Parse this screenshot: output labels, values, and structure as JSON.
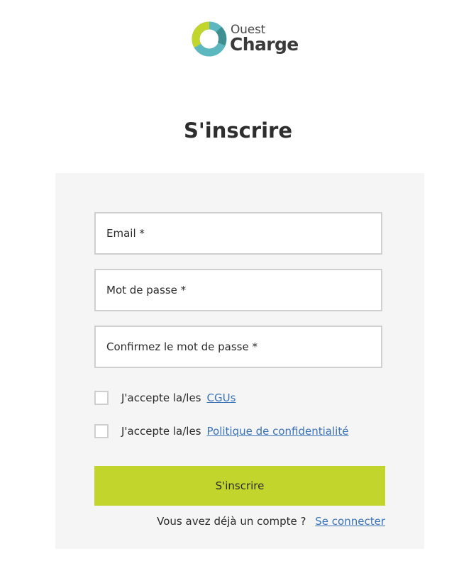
{
  "brand": {
    "logo_line1": "Ouest",
    "logo_line2": "Charge",
    "colors": {
      "lime": "#c2d52c",
      "teal": "#5cb8be",
      "dark_teal": "#3f8e92"
    }
  },
  "header": {
    "title": "S'inscrire"
  },
  "form": {
    "email_placeholder": "Email *",
    "password_placeholder": "Mot de passe *",
    "confirm_placeholder": "Confirmez le mot de passe *",
    "cgu": {
      "text": "J'accepte la/les",
      "link": "CGUs"
    },
    "privacy": {
      "text": "J'accepte la/les",
      "link": "Politique de confidentialité"
    },
    "submit_label": "S'inscrire",
    "login_prompt": "Vous avez déjà un compte ?",
    "login_link": "Se connecter"
  },
  "colors": {
    "button_bg": "#c2d52c",
    "link": "#3b73b9",
    "card_bg": "#f5f5f5"
  }
}
